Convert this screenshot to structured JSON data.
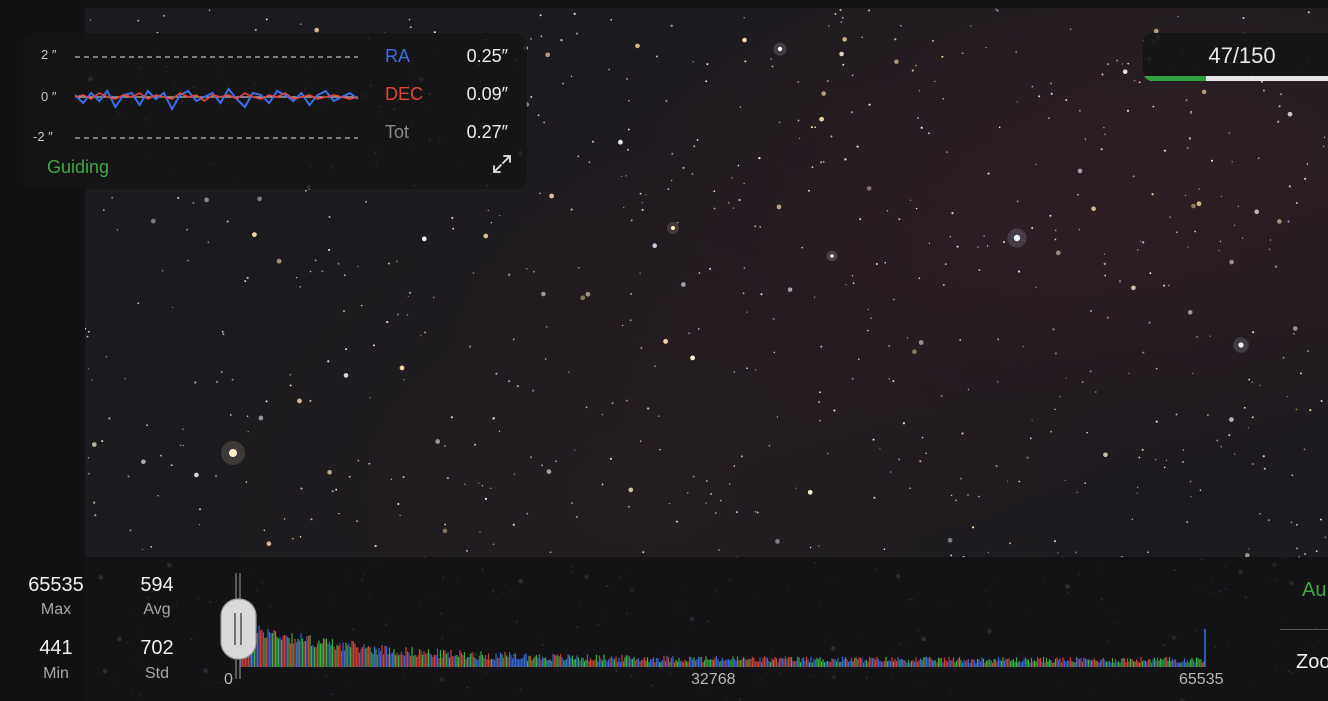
{
  "guiding": {
    "axis_labels": [
      "2 ″",
      "0 ″",
      "-2 ″"
    ],
    "status": "Guiding",
    "ra": {
      "label": "RA",
      "value": "0.25″",
      "color": "#3b6fe8"
    },
    "dec": {
      "label": "DEC",
      "value": "0.09″",
      "color": "#e0473a"
    },
    "tot": {
      "label": "Tot",
      "value": "0.27″",
      "color": "#8a8a8a"
    },
    "ra_series": [
      0.1,
      -0.3,
      0.2,
      -0.2,
      0.3,
      -0.5,
      0.1,
      0.2,
      -0.4,
      0.3,
      -0.1,
      0.2,
      -0.6,
      0.1,
      0.3,
      -0.2,
      0.0,
      0.2,
      -0.3,
      0.4,
      -0.1,
      -0.5,
      0.2,
      0.1,
      -0.3,
      0.3,
      0.1,
      -0.2,
      0.2,
      -0.4,
      0.1,
      0.3,
      -0.2,
      0.0,
      0.2,
      -0.1
    ],
    "dec_series": [
      0.0,
      0.1,
      -0.1,
      0.2,
      0.0,
      -0.1,
      0.1,
      0.0,
      0.2,
      -0.1,
      0.1,
      0.0,
      -0.1,
      0.2,
      0.0,
      0.1,
      -0.2,
      0.1,
      0.0,
      0.1,
      -0.1,
      0.2,
      0.0,
      -0.1,
      0.1,
      0.0,
      0.2,
      -0.1,
      0.0,
      0.1,
      -0.1,
      0.0,
      0.1,
      0.0,
      -0.1,
      0.0
    ]
  },
  "frames": {
    "text": "47/150",
    "current": 47,
    "total": 150,
    "color": "#2fa140"
  },
  "histogram": {
    "stats": {
      "max": {
        "value": "65535",
        "label": "Max"
      },
      "avg": {
        "value": "594",
        "label": "Avg"
      },
      "min": {
        "value": "441",
        "label": "Min"
      },
      "std": {
        "value": "702",
        "label": "Std"
      }
    },
    "ticks": [
      "0",
      "32768",
      "65535"
    ],
    "auto_label": "Au",
    "zoom_label": "Zoo"
  }
}
